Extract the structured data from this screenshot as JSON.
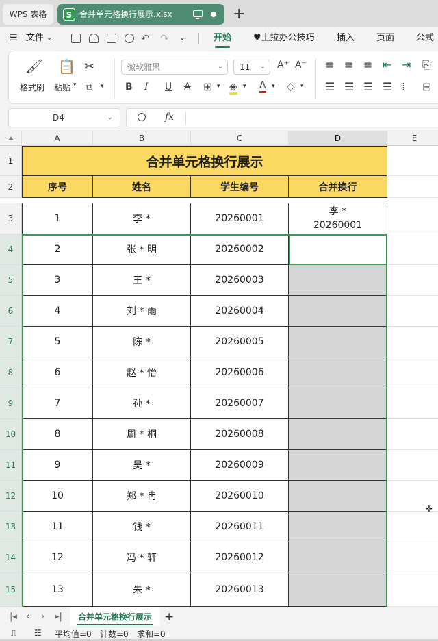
{
  "window": {
    "home_tab": "WPS 表格",
    "doc_tab": "合并单元格换行展示.xlsx",
    "doc_icon": "S"
  },
  "menu": {
    "file": "文件",
    "tabs": [
      "开始",
      "♥土拉办公技巧",
      "插入",
      "页面",
      "公式"
    ]
  },
  "ribbon": {
    "format_painter": "格式刷",
    "paste": "粘贴",
    "font_name": "微软雅黑",
    "font_size": "11",
    "bold": "B",
    "italic": "I",
    "underline": "U",
    "strike": "A"
  },
  "formula_bar": {
    "cell_ref": "D4",
    "fx": "fx",
    "content": ""
  },
  "sheet": {
    "columns": [
      "A",
      "B",
      "C",
      "D",
      "E"
    ],
    "title": "合并单元格换行展示",
    "headers": [
      "序号",
      "姓名",
      "学生编号",
      "合并换行"
    ],
    "row_numbers": [
      "1",
      "2",
      "3",
      "4",
      "5",
      "6",
      "7",
      "8",
      "9",
      "10",
      "11",
      "12",
      "13",
      "14",
      "15"
    ],
    "rows": [
      {
        "no": "1",
        "name": "李 *",
        "id": "20260001",
        "merged_line1": "李 *",
        "merged_line2": "20260001"
      },
      {
        "no": "2",
        "name": "张 * 明",
        "id": "20260002",
        "merged_line1": "",
        "merged_line2": ""
      },
      {
        "no": "3",
        "name": "王 *",
        "id": "20260003",
        "merged_line1": "",
        "merged_line2": ""
      },
      {
        "no": "4",
        "name": "刘 * 雨",
        "id": "20260004",
        "merged_line1": "",
        "merged_line2": ""
      },
      {
        "no": "5",
        "name": "陈 *",
        "id": "20260005",
        "merged_line1": "",
        "merged_line2": ""
      },
      {
        "no": "6",
        "name": "赵 * 怡",
        "id": "20260006",
        "merged_line1": "",
        "merged_line2": ""
      },
      {
        "no": "7",
        "name": "孙 *",
        "id": "20260007",
        "merged_line1": "",
        "merged_line2": ""
      },
      {
        "no": "8",
        "name": "周 * 桐",
        "id": "20260008",
        "merged_line1": "",
        "merged_line2": ""
      },
      {
        "no": "9",
        "name": "吴 *",
        "id": "20260009",
        "merged_line1": "",
        "merged_line2": ""
      },
      {
        "no": "10",
        "name": "郑 * 冉",
        "id": "20260010",
        "merged_line1": "",
        "merged_line2": ""
      },
      {
        "no": "11",
        "name": "钱 *",
        "id": "20260011",
        "merged_line1": "",
        "merged_line2": ""
      },
      {
        "no": "12",
        "name": "冯 * 轩",
        "id": "20260012",
        "merged_line1": "",
        "merged_line2": ""
      },
      {
        "no": "13",
        "name": "朱 *",
        "id": "20260013",
        "merged_line1": "",
        "merged_line2": ""
      }
    ]
  },
  "sheet_tabs": {
    "active": "合并单元格换行展示",
    "add": "+"
  },
  "status": {
    "average": "平均值=0",
    "count": "计数=0",
    "sum": "求和=0"
  },
  "colors": {
    "header_fill": "#fad861",
    "accent": "#1f7a52",
    "selection_border": "#3d9a4f",
    "selection_fill": "#d6d6d6",
    "doc_tab": "#4e8c73"
  }
}
